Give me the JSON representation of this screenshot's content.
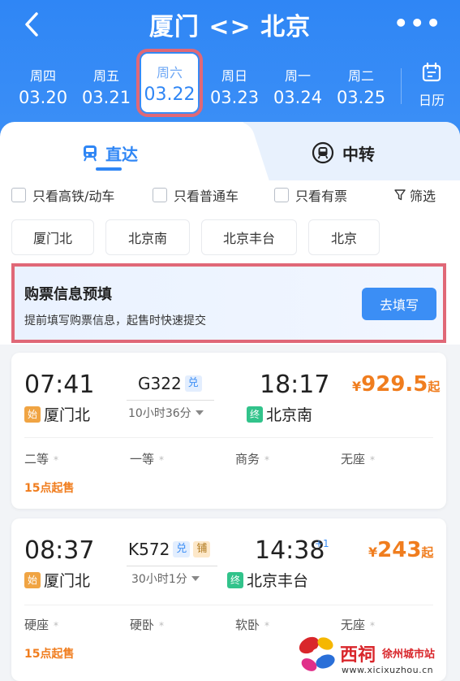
{
  "header": {
    "title": "厦门 <> 北京",
    "more": "•••"
  },
  "dates": [
    {
      "weekday": "周四",
      "date": "03.20",
      "selected": false
    },
    {
      "weekday": "周五",
      "date": "03.21",
      "selected": false
    },
    {
      "weekday": "周六",
      "date": "03.22",
      "selected": true
    },
    {
      "weekday": "周日",
      "date": "03.23",
      "selected": false
    },
    {
      "weekday": "周一",
      "date": "03.24",
      "selected": false
    },
    {
      "weekday": "周二",
      "date": "03.25",
      "selected": false
    }
  ],
  "calendar_label": "日历",
  "tabs": {
    "direct": "直达",
    "transfer": "中转"
  },
  "filters": {
    "high_speed": "只看高铁/动车",
    "normal": "只看普通车",
    "available": "只看有票",
    "screen": "筛选"
  },
  "stations": [
    "厦门北",
    "北京南",
    "北京丰台",
    "北京"
  ],
  "banner": {
    "title": "购票信息预填",
    "subtitle": "提前填写购票信息，起售时快速提交",
    "button": "去填写"
  },
  "trains": [
    {
      "depart_time": "07:41",
      "depart_tag": "始",
      "depart_station": "厦门北",
      "code": "G322",
      "badges": [
        "兑"
      ],
      "duration": "10小时36分",
      "arrive_time": "18:17",
      "arrive_tag": "终",
      "arrive_station": "北京南",
      "price_symbol": "¥",
      "price": "929.5",
      "price_suffix": "起",
      "seats": [
        "二等",
        "一等",
        "商务",
        "无座"
      ],
      "seat_status": "*",
      "sale_note": "15点起售"
    },
    {
      "depart_time": "08:37",
      "depart_tag": "始",
      "depart_station": "厦门北",
      "code": "K572",
      "badges": [
        "兑",
        "铺"
      ],
      "duration": "30小时1分",
      "arrive_time": "14:38",
      "arrive_offset": "+1",
      "arrive_tag": "终",
      "arrive_station": "北京丰台",
      "price_symbol": "¥",
      "price": "243",
      "price_suffix": "起",
      "seats": [
        "硬座",
        "硬卧",
        "软卧",
        "无座"
      ],
      "seat_status": "*",
      "sale_note": "15点起售"
    }
  ],
  "watermark": {
    "name": "西祠",
    "site": "徐州城市站",
    "url": "www.xicixuzhou.cn"
  },
  "colors": {
    "primary": "#2f86f5",
    "highlight_border": "#e06877",
    "price": "#f07d1e",
    "start_tag": "#f0a443",
    "end_tag": "#32c38b"
  }
}
